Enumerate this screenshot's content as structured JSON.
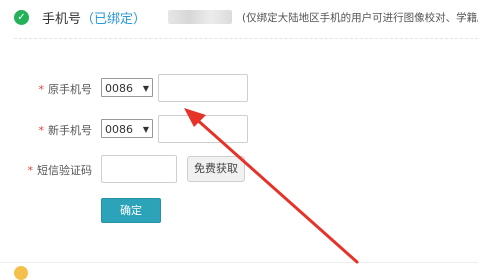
{
  "header": {
    "title": "手机号",
    "bound_status": "（已绑定）",
    "note": "(仅绑定大陆地区手机的用户可进行图像校对、学籍/"
  },
  "form": {
    "old_phone": {
      "label": "原手机号",
      "country_code": "0086",
      "value": ""
    },
    "new_phone": {
      "label": "新手机号",
      "country_code": "0086",
      "value": ""
    },
    "sms_code": {
      "label": "短信验证码",
      "value": "",
      "get_code_button": "免费获取"
    },
    "submit_button": "确定"
  },
  "annotation": {
    "arrow_color": "#e5332a"
  }
}
